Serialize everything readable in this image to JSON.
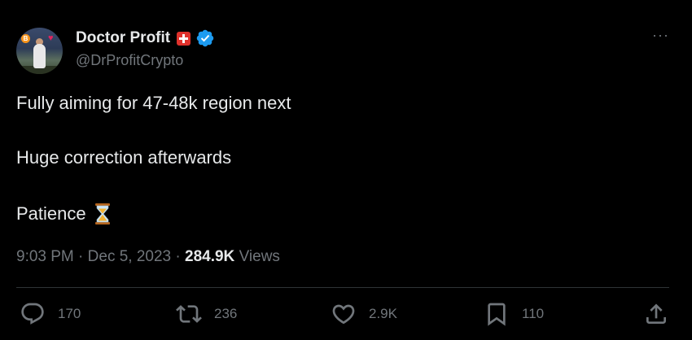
{
  "author": {
    "display_name": "Doctor Profit",
    "handle": "@DrProfitCrypto",
    "avatar_badge": "B",
    "avatar_heart": "♥"
  },
  "tweet": {
    "lines": [
      "Fully aiming for 47-48k region next",
      "Huge correction afterwards",
      "Patience"
    ]
  },
  "meta": {
    "time": "9:03 PM",
    "separator1": " · ",
    "date": "Dec 5, 2023",
    "separator2": " · ",
    "views_count": "284.9K",
    "views_label": " Views"
  },
  "actions": {
    "replies": "170",
    "reposts": "236",
    "likes": "2.9K",
    "bookmarks": "110"
  },
  "more_menu": "···",
  "colors": {
    "background": "#000000",
    "text_primary": "#e7e9ea",
    "text_secondary": "#71767b",
    "verified_blue": "#1d9bf0",
    "flag_red": "#e0312b",
    "divider": "#2f3336"
  }
}
